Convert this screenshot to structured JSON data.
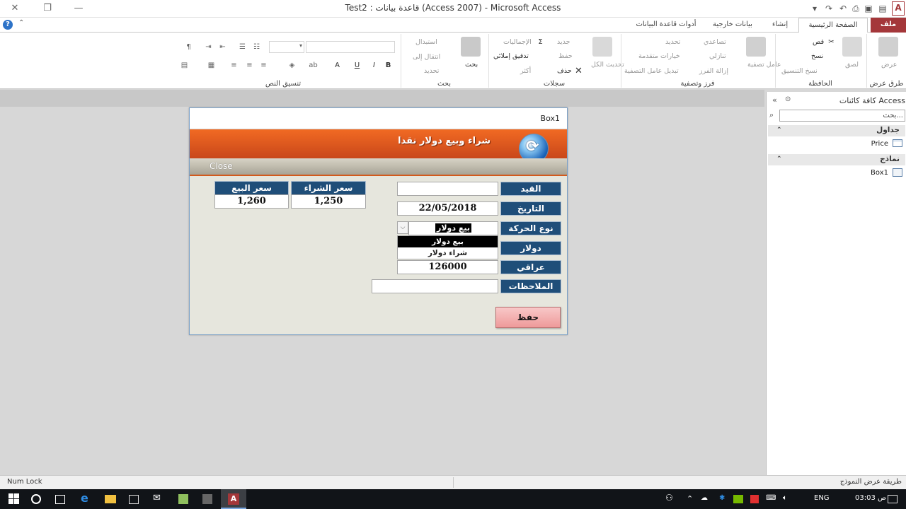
{
  "window": {
    "title": "Test2 : قاعدة بيانات (Access 2007) - Microsoft Access",
    "app_badge": "A"
  },
  "tabs": [
    {
      "label": "ملف"
    },
    {
      "label": "الصفحة الرئيسية"
    },
    {
      "label": "إنشاء"
    },
    {
      "label": "بيانات خارجية"
    },
    {
      "label": "أدوات قاعدة البيانات"
    }
  ],
  "ribbon": {
    "views": {
      "label": "عرض",
      "group": "طرق عرض"
    },
    "clipboard": {
      "paste": "لصق",
      "cut": "قص",
      "copy": "نسخ",
      "format_painter": "نسخ التنسيق",
      "group": "الحافظة"
    },
    "sort_filter": {
      "filter": "عامل تصفية",
      "ascending": "تصاعدي",
      "descending": "تنازلي",
      "remove_sort": "إزالة الفرز",
      "selection": "تحديد",
      "advanced": "خيارات متقدمة",
      "toggle_filter": "تبديل عامل التصفية",
      "group": "فرز وتصفية"
    },
    "records": {
      "refresh": "تحديث الكل",
      "new": "جديد",
      "save": "حفظ",
      "delete": "حذف",
      "totals": "الإجماليات",
      "spelling": "تدقيق إملائي",
      "more": "أكثر",
      "group": "سجلات"
    },
    "find": {
      "find": "بحث",
      "replace": "استبدال",
      "goto": "انتقال إلى",
      "select": "تحديد",
      "group": "بحث"
    },
    "text_format": {
      "group": "تنسيق النص",
      "bold": "B",
      "italic": "I",
      "underline": "U"
    }
  },
  "nav_pane": {
    "header": "كافة كائنات Access",
    "search_placeholder": "بحث...",
    "sections": [
      {
        "title": "جداول",
        "items": [
          {
            "label": "Price"
          }
        ]
      },
      {
        "title": "نماذج",
        "items": [
          {
            "label": "Box1"
          }
        ]
      }
    ]
  },
  "form": {
    "tab_title": "Box1",
    "banner_title": "شراء وبيع دولار نقدا",
    "close_label": "Close",
    "labels": {
      "entry": "القيد",
      "date": "التاريخ",
      "type": "نوع الحركة",
      "dollar": "دولار",
      "iraqi": "عراقي",
      "notes": "الملاحظات",
      "buy_price": "سعر الشراء",
      "sell_price": "سعر البيع"
    },
    "values": {
      "entry": "",
      "date": "22/05/2018",
      "type": "بيع دولار",
      "iraqi": "126000",
      "notes": "",
      "buy_price": "1,250",
      "sell_price": "1,260"
    },
    "type_options": [
      "بيع دولار",
      "شراء دولار"
    ],
    "save_label": "حفظ"
  },
  "statusbar": {
    "left": "Num Lock",
    "right": "طريقة عرض النموذج"
  },
  "taskbar": {
    "lang": "ENG",
    "time": "03:03 ص"
  },
  "colors": {
    "file_tab": "#a4373a",
    "banner": "#e85d20",
    "label_bg": "#1f4e79",
    "save_btn": "#f2a9a9"
  }
}
